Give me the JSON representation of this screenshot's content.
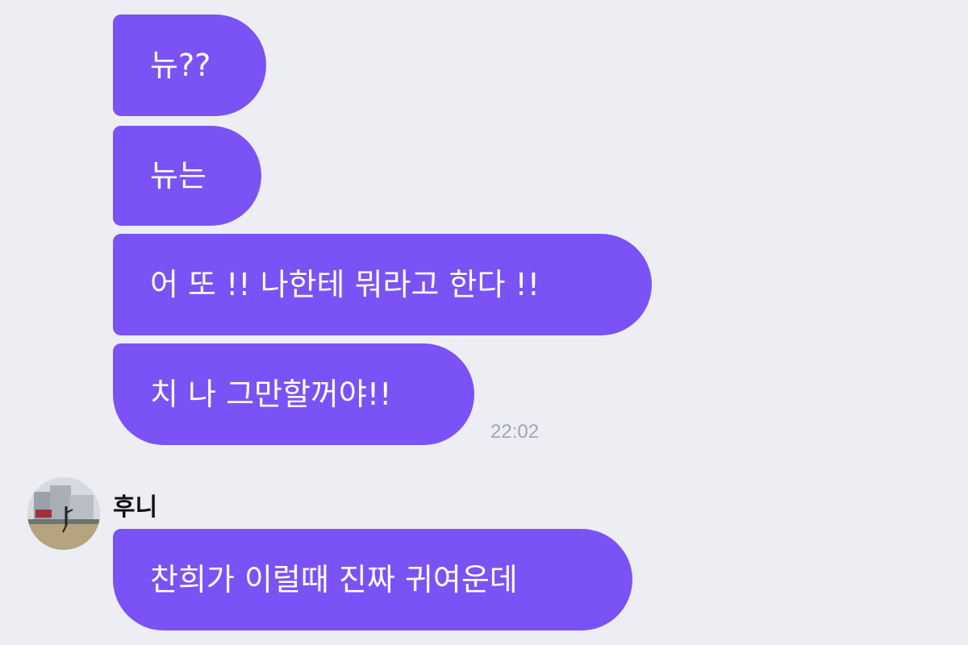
{
  "messages_sent": [
    {
      "text": "뉴??"
    },
    {
      "text": "뉴는"
    },
    {
      "text": "어 또 !! 나한테 뭐라고 한다 !!"
    },
    {
      "text": "치 나 그만할꺼야!!"
    }
  ],
  "sent_time": "22:02",
  "incoming": {
    "sender": "후니",
    "avatar": "profile-photo",
    "text": "찬희가 이럴때 진짜 귀여운데"
  },
  "colors": {
    "bubble": "#7b52f5",
    "background": "#eceef3",
    "timestamp": "#a3a6ad"
  }
}
